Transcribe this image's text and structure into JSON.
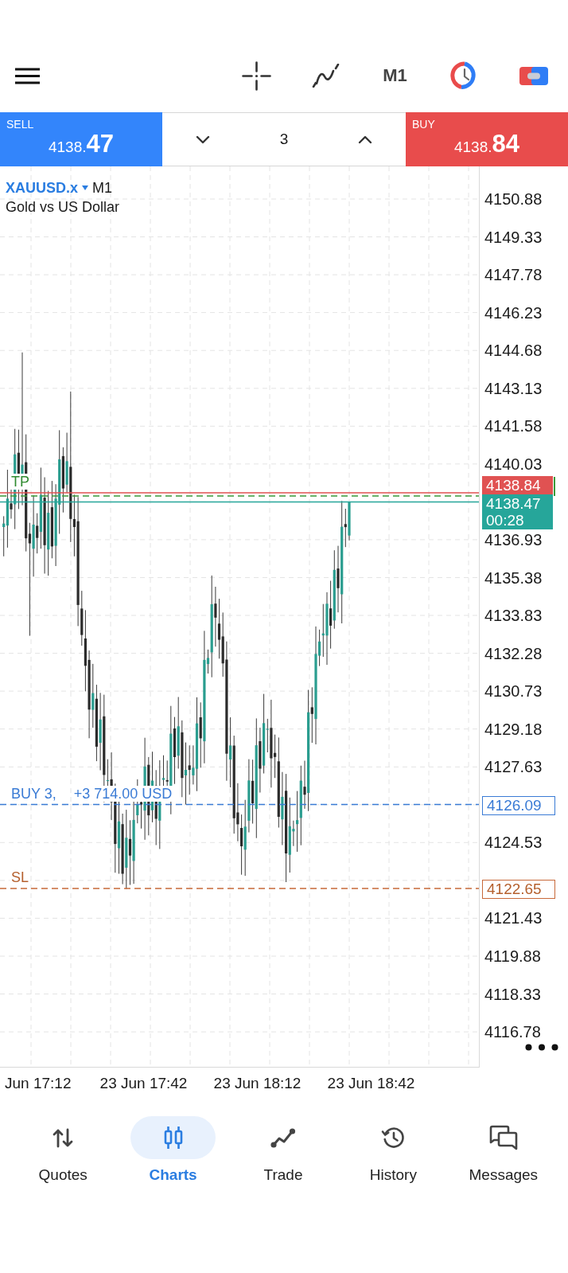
{
  "toolbar": {
    "timeframe": "M1"
  },
  "trade_panel": {
    "sell": {
      "label": "SELL",
      "price_prefix": "4138.",
      "price_digits": "47"
    },
    "volume": "3",
    "buy": {
      "label": "BUY",
      "price_prefix": "4138.",
      "price_digits": "84"
    }
  },
  "chart": {
    "symbol": "XAUUSD.x",
    "timeframe": "M1",
    "description": "Gold vs US Dollar",
    "price_axis": [
      "4150.88",
      "4149.33",
      "4147.78",
      "4146.23",
      "4144.68",
      "4143.13",
      "4141.58",
      "4140.03",
      "4136.93",
      "4135.38",
      "4133.83",
      "4132.28",
      "4130.73",
      "4129.18",
      "4127.63",
      "4124.53",
      "4121.43",
      "4119.88",
      "4118.33",
      "4116.78"
    ],
    "price_lines": [
      {
        "kind": "take_profit",
        "label": "TP"
      },
      {
        "kind": "ask",
        "tag": "4138.84"
      },
      {
        "kind": "bid",
        "tag": "4138.47",
        "countdown": "00:28"
      },
      {
        "kind": "position",
        "label": "BUY 3,",
        "profit": "+3 714.00 USD",
        "tag": "4126.09"
      },
      {
        "kind": "stop_loss",
        "label": "SL",
        "tag": "4122.65"
      }
    ],
    "time_axis": [
      "Jun 17:12",
      "23 Jun 17:42",
      "23 Jun 18:12",
      "23 Jun 18:42"
    ]
  },
  "bottom_nav": [
    {
      "label": "Quotes",
      "selected": false
    },
    {
      "label": "Charts",
      "selected": true
    },
    {
      "label": "Trade",
      "selected": false
    },
    {
      "label": "History",
      "selected": false
    },
    {
      "label": "Messages",
      "selected": false
    }
  ]
}
